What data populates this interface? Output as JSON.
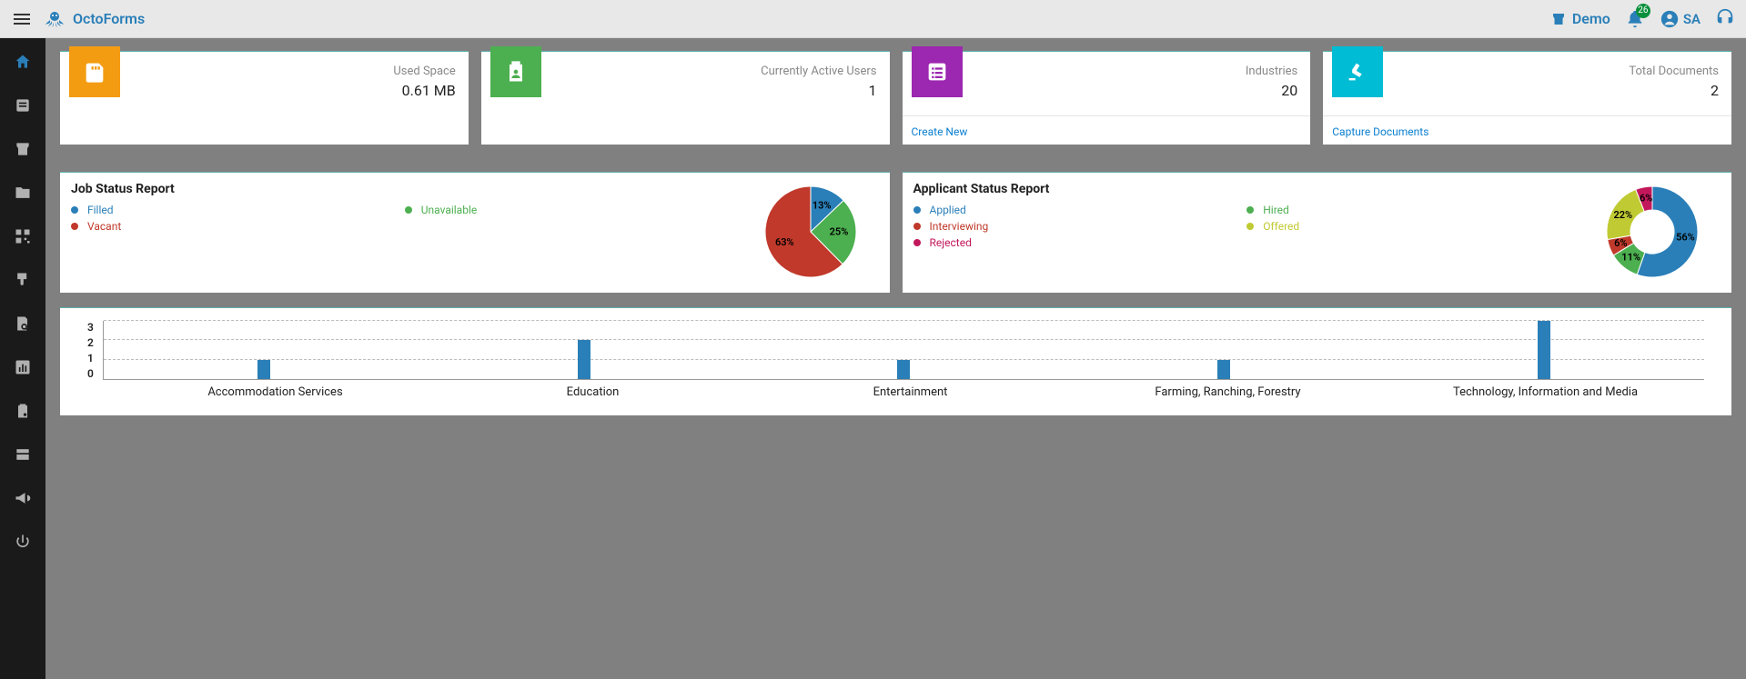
{
  "header": {
    "brand": "OctoForms",
    "demo_label": "Demo",
    "notif_count": "26",
    "user_initials": "SA"
  },
  "stats": {
    "used_space": {
      "label": "Used Space",
      "value": "0.61 MB"
    },
    "active_users": {
      "label": "Currently Active Users",
      "value": "1"
    },
    "industries": {
      "label": "Industries",
      "value": "20",
      "link": "Create New"
    },
    "documents": {
      "label": "Total Documents",
      "value": "2",
      "link": "Capture Documents"
    }
  },
  "job_report": {
    "title": "Job Status Report",
    "legend": [
      {
        "label": "Filled",
        "color": "#2a7fb8"
      },
      {
        "label": "Unavailable",
        "color": "#4caf50"
      },
      {
        "label": "Vacant",
        "color": "#c0392b"
      }
    ]
  },
  "applicant_report": {
    "title": "Applicant Status Report",
    "legend": [
      {
        "label": "Applied",
        "color": "#2a7fb8"
      },
      {
        "label": "Hired",
        "color": "#4caf50"
      },
      {
        "label": "Interviewing",
        "color": "#c0392b"
      },
      {
        "label": "Offered",
        "color": "#c0ca33"
      },
      {
        "label": "Rejected",
        "color": "#c2185b"
      }
    ]
  },
  "chart_data": [
    {
      "type": "pie",
      "title": "Job Status Report",
      "series": [
        {
          "name": "Filled",
          "value": 13,
          "color": "#2a7fb8"
        },
        {
          "name": "Unavailable",
          "value": 25,
          "color": "#4caf50"
        },
        {
          "name": "Vacant",
          "value": 63,
          "color": "#c0392b"
        }
      ],
      "labels_pct": [
        "13%",
        "25%",
        "63%"
      ]
    },
    {
      "type": "pie",
      "title": "Applicant Status Report",
      "donut": true,
      "series": [
        {
          "name": "Applied",
          "value": 56,
          "color": "#2a7fb8"
        },
        {
          "name": "Hired",
          "value": 11,
          "color": "#4caf50"
        },
        {
          "name": "Interviewing",
          "value": 6,
          "color": "#c0392b"
        },
        {
          "name": "Offered",
          "value": 22,
          "color": "#c0ca33"
        },
        {
          "name": "Rejected",
          "value": 6,
          "color": "#c2185b"
        }
      ],
      "labels_pct": [
        "56%",
        "11%",
        "6%",
        "22%",
        "6%"
      ]
    },
    {
      "type": "bar",
      "categories": [
        "Accommodation Services",
        "Education",
        "Entertainment",
        "Farming, Ranching, Forestry",
        "Technology, Information and Media"
      ],
      "values": [
        1,
        2,
        1,
        1,
        3
      ],
      "ylim": [
        0,
        3
      ],
      "yticks": [
        0,
        1,
        2,
        3
      ]
    }
  ]
}
